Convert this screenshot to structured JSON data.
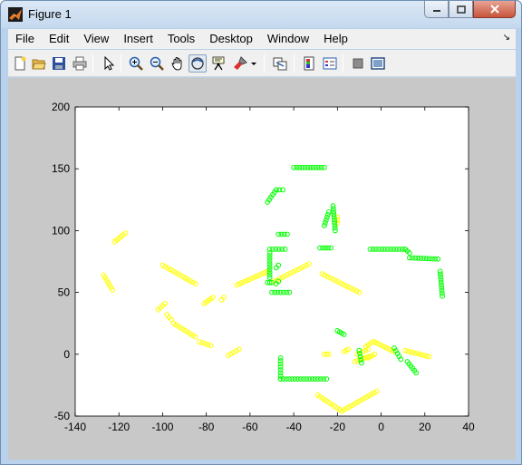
{
  "window": {
    "title": "Figure 1"
  },
  "menu": [
    "File",
    "Edit",
    "View",
    "Insert",
    "Tools",
    "Desktop",
    "Window",
    "Help"
  ],
  "toolbar": [
    "new-figure-icon",
    "open-file-icon",
    "save-icon",
    "print-icon",
    "edit-plot-arrow-icon",
    "zoom-in-icon",
    "zoom-out-icon",
    "pan-hand-icon",
    "rotate-3d-icon",
    "data-cursor-icon",
    "brush-icon",
    "link-plot-icon",
    "insert-colorbar-icon",
    "insert-legend-icon",
    "hide-plot-tools-icon",
    "show-plot-tools-icon"
  ],
  "colors": {
    "series_yellow": "#ffff00",
    "series_green": "#00ff00",
    "axes_bg": "#ffffff",
    "figure_bg": "#c8c8c8"
  },
  "chart_data": {
    "type": "scatter",
    "marker": "circle-open",
    "xlim": [
      -140,
      40
    ],
    "ylim": [
      -50,
      200
    ],
    "xticks": [
      -140,
      -120,
      -100,
      -80,
      -60,
      -40,
      -20,
      0,
      20,
      40
    ],
    "yticks": [
      -50,
      0,
      50,
      100,
      150,
      200
    ],
    "grid": false,
    "series": [
      {
        "color": "#ffff00",
        "segments": [
          [
            [
              -122,
              91
            ],
            [
              -117,
              98
            ]
          ],
          [
            [
              -127,
              64
            ],
            [
              -123,
              52
            ]
          ],
          [
            [
              -102,
              36
            ],
            [
              -99,
              41
            ]
          ],
          [
            [
              -98,
              32
            ],
            [
              -96,
              28
            ]
          ],
          [
            [
              -95,
              25
            ],
            [
              -85,
              14
            ]
          ],
          [
            [
              -83,
              10
            ],
            [
              -78,
              7
            ]
          ],
          [
            [
              -81,
              41
            ],
            [
              -77,
              46
            ]
          ],
          [
            [
              -100,
              72
            ],
            [
              -85,
              57
            ]
          ],
          [
            [
              -73,
              44
            ],
            [
              -72,
              46
            ]
          ],
          [
            [
              -70,
              -1
            ],
            [
              -65,
              4
            ]
          ],
          [
            [
              -66,
              56
            ],
            [
              -52,
              67
            ]
          ],
          [
            [
              -50,
              58
            ],
            [
              -33,
              73
            ]
          ],
          [
            [
              -27,
              65
            ],
            [
              -10,
              50
            ]
          ],
          [
            [
              -29,
              -33
            ],
            [
              -18,
              -46
            ]
          ],
          [
            [
              -18,
              -46
            ],
            [
              -2,
              -30
            ]
          ],
          [
            [
              -12,
              -6
            ],
            [
              -6,
              -2
            ]
          ],
          [
            [
              -11,
              0
            ],
            [
              -6,
              4
            ]
          ],
          [
            [
              -6,
              -3
            ],
            [
              -3,
              0
            ]
          ],
          [
            [
              -7,
              6
            ],
            [
              -4,
              10
            ]
          ],
          [
            [
              -3,
              10
            ],
            [
              6,
              2
            ]
          ],
          [
            [
              11,
              3
            ],
            [
              22,
              -2
            ]
          ],
          [
            [
              -26,
              0
            ],
            [
              -24,
              0
            ]
          ],
          [
            [
              -17,
              2
            ],
            [
              -15,
              4
            ]
          ],
          [
            [
              -20,
              111
            ],
            [
              -20,
              106
            ]
          ]
        ]
      },
      {
        "color": "#00ff00",
        "segments": [
          [
            [
              -40,
              151
            ],
            [
              -26,
              151
            ]
          ],
          [
            [
              -52,
              123
            ],
            [
              -48,
              133
            ]
          ],
          [
            [
              -48,
              133
            ],
            [
              -45,
              133
            ]
          ],
          [
            [
              -22,
              120
            ],
            [
              -21,
              100
            ]
          ],
          [
            [
              -26,
              104
            ],
            [
              -24,
              115
            ]
          ],
          [
            [
              -28,
              86
            ],
            [
              -23,
              86
            ]
          ],
          [
            [
              -47,
              97
            ],
            [
              -43,
              97
            ]
          ],
          [
            [
              -51,
              85
            ],
            [
              -44,
              85
            ]
          ],
          [
            [
              -51,
              82
            ],
            [
              -51,
              62
            ]
          ],
          [
            [
              -48,
              70
            ],
            [
              -47,
              72
            ]
          ],
          [
            [
              -50,
              50
            ],
            [
              -42,
              50
            ]
          ],
          [
            [
              -48,
              57
            ],
            [
              -47,
              59
            ]
          ],
          [
            [
              -52,
              58
            ],
            [
              -50,
              58
            ]
          ],
          [
            [
              -5,
              85
            ],
            [
              11,
              85
            ]
          ],
          [
            [
              11,
              85
            ],
            [
              13,
              82
            ]
          ],
          [
            [
              13,
              78
            ],
            [
              26,
              77
            ]
          ],
          [
            [
              27,
              67
            ],
            [
              28,
              47
            ]
          ],
          [
            [
              -46,
              -20
            ],
            [
              -25,
              -20
            ]
          ],
          [
            [
              -46,
              -3
            ],
            [
              -46,
              -20
            ]
          ],
          [
            [
              -10,
              3
            ],
            [
              -9,
              -7
            ]
          ],
          [
            [
              6,
              5
            ],
            [
              9,
              -4
            ]
          ],
          [
            [
              12,
              -6
            ],
            [
              16,
              -15
            ]
          ],
          [
            [
              -20,
              19
            ],
            [
              -17,
              16
            ]
          ]
        ]
      }
    ]
  }
}
